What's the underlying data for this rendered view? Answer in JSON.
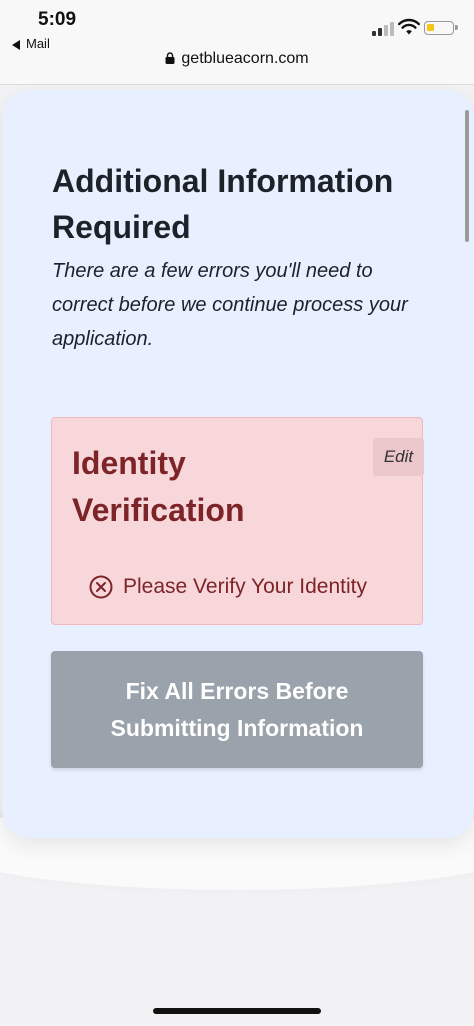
{
  "status_bar": {
    "time": "5:09",
    "back_app": "Mail",
    "url": "getblueacorn.com",
    "icons": [
      "signal-icon",
      "wifi-icon",
      "battery-icon",
      "lock-icon"
    ]
  },
  "page": {
    "title": "Additional Information Required",
    "subtitle": "There are a few errors you'll need to correct before we continue process your application."
  },
  "error_section": {
    "title": "Identity Verification",
    "edit_label": "Edit",
    "error_message": "Please Verify Your Identity",
    "icon": "circle-x-icon"
  },
  "submit": {
    "label": "Fix All Errors Before Submitting Information",
    "disabled": true
  },
  "colors": {
    "card_background": "#e8efff",
    "error_background": "#f8d7da",
    "error_text": "#7c2428",
    "button_disabled": "#9aa2ab",
    "battery_level": "#f5c518"
  }
}
